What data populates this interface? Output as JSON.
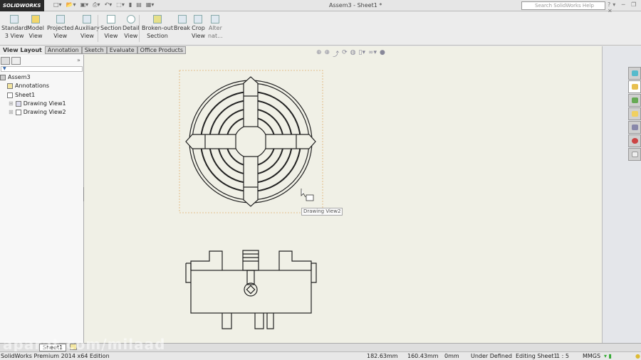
{
  "app": {
    "logo": "SOLIDWORKS",
    "document_title": "Assem3 - Sheet1 *",
    "search_placeholder": "Search SolidWorks Help"
  },
  "ribbon": [
    {
      "line1": "Standard",
      "line2": "3 View"
    },
    {
      "line1": "Model",
      "line2": "View"
    },
    {
      "line1": "Projected",
      "line2": "View"
    },
    {
      "line1": "Auxiliary",
      "line2": "View"
    },
    {
      "line1": "Section",
      "line2": "View"
    },
    {
      "line1": "Detail",
      "line2": "View"
    },
    {
      "line1": "Broken-out",
      "line2": "Section"
    },
    {
      "line1": "Break",
      "line2": ""
    },
    {
      "line1": "Crop",
      "line2": "View"
    },
    {
      "line1": "Alter",
      "line2": "nat..."
    }
  ],
  "tabs": [
    "View Layout",
    "Annotation",
    "Sketch",
    "Evaluate",
    "Office Products"
  ],
  "tree": {
    "root": "Assem3",
    "items": [
      "Annotations",
      "Sheet1",
      "Drawing View1",
      "Drawing View2"
    ]
  },
  "canvas": {
    "tooltip": "Drawing View2"
  },
  "sheet_tab": "Sheet1",
  "watermark": "aparat.com/milaad",
  "status": {
    "edition": "SolidWorks Premium 2014 x64 Edition",
    "x": "182.63mm",
    "y": "160.43mm",
    "z": "0mm",
    "state": "Under Defined",
    "editing": "Editing Sheet1",
    "scale": "1 : 5",
    "units": "MMGS"
  }
}
